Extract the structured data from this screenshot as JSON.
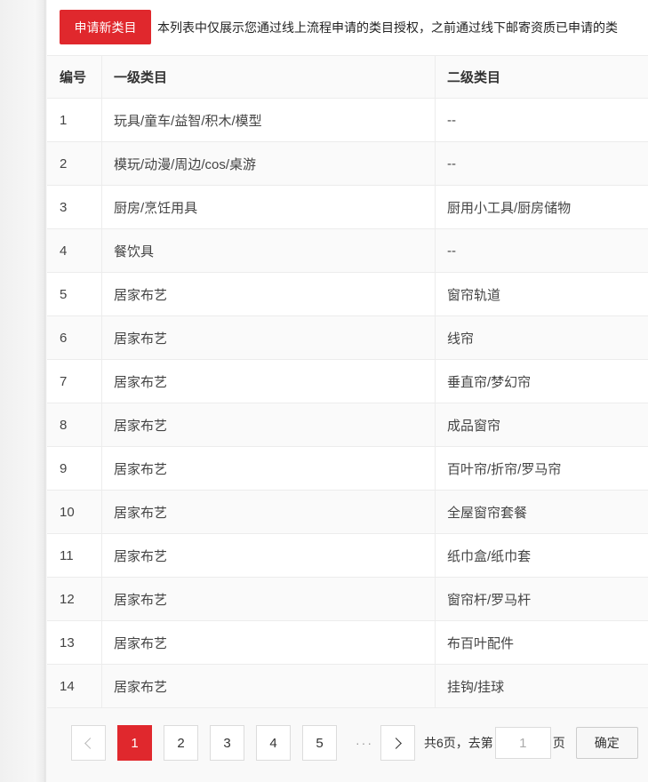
{
  "toolbar": {
    "apply_label": "申请新类目",
    "notice": "本列表中仅展示您通过线上流程申请的类目授权，之前通过线下邮寄资质已申请的类"
  },
  "table": {
    "headers": {
      "no": "编号",
      "level1": "一级类目",
      "level2": "二级类目"
    },
    "rows": [
      {
        "no": "1",
        "level1": "玩具/童车/益智/积木/模型",
        "level2": "--"
      },
      {
        "no": "2",
        "level1": "模玩/动漫/周边/cos/桌游",
        "level2": "--"
      },
      {
        "no": "3",
        "level1": "厨房/烹饪用具",
        "level2": "厨用小工具/厨房储物"
      },
      {
        "no": "4",
        "level1": "餐饮具",
        "level2": "--"
      },
      {
        "no": "5",
        "level1": "居家布艺",
        "level2": "窗帘轨道"
      },
      {
        "no": "6",
        "level1": "居家布艺",
        "level2": "线帘"
      },
      {
        "no": "7",
        "level1": "居家布艺",
        "level2": "垂直帘/梦幻帘"
      },
      {
        "no": "8",
        "level1": "居家布艺",
        "level2": "成品窗帘"
      },
      {
        "no": "9",
        "level1": "居家布艺",
        "level2": "百叶帘/折帘/罗马帘"
      },
      {
        "no": "10",
        "level1": "居家布艺",
        "level2": "全屋窗帘套餐"
      },
      {
        "no": "11",
        "level1": "居家布艺",
        "level2": "纸巾盒/纸巾套"
      },
      {
        "no": "12",
        "level1": "居家布艺",
        "level2": "窗帘杆/罗马杆"
      },
      {
        "no": "13",
        "level1": "居家布艺",
        "level2": "布百叶配件"
      },
      {
        "no": "14",
        "level1": "居家布艺",
        "level2": "挂钩/挂球"
      }
    ]
  },
  "pagination": {
    "pages": [
      "1",
      "2",
      "3",
      "4",
      "5"
    ],
    "current": "1",
    "ellipsis": "···",
    "total_text": "共6页，去第",
    "input_value": "1",
    "page_suffix": "页",
    "confirm_label": "确定"
  },
  "colors": {
    "accent": "#e0282d"
  }
}
